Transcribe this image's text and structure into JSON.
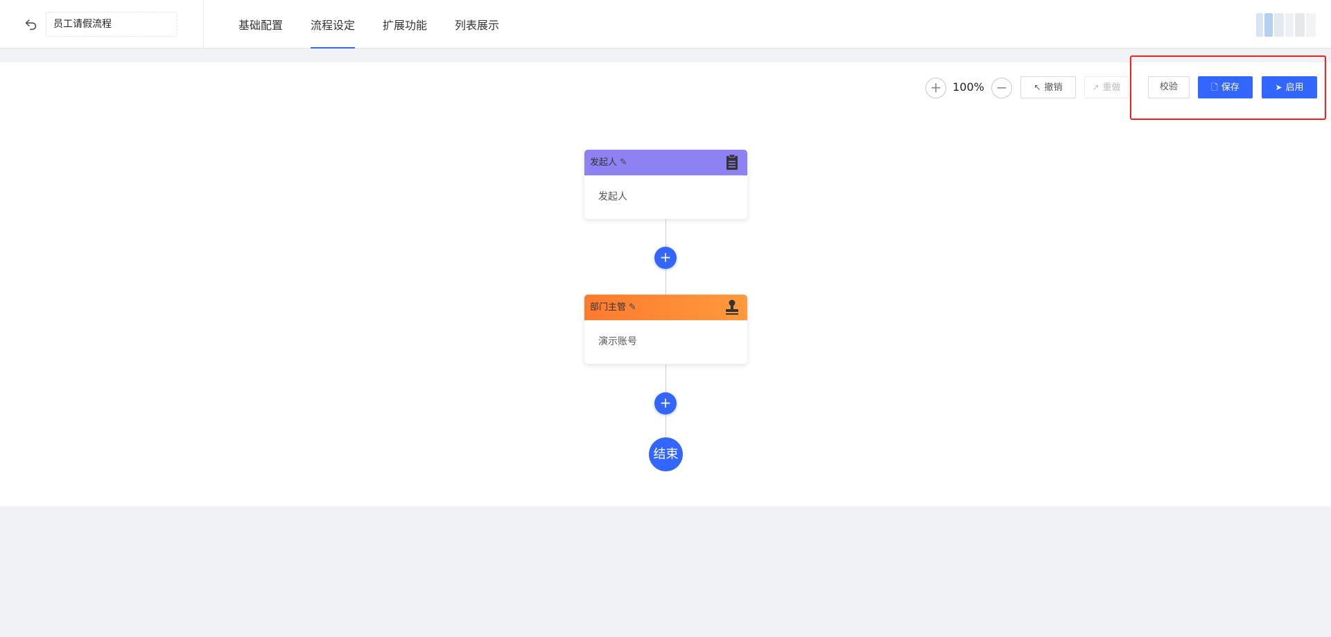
{
  "header": {
    "title": "员工请假流程",
    "tabs": [
      {
        "label": "基础配置",
        "active": false
      },
      {
        "label": "流程设定",
        "active": true
      },
      {
        "label": "扩展功能",
        "active": false
      },
      {
        "label": "列表展示",
        "active": false
      }
    ]
  },
  "toolbar": {
    "zoom_in": "+",
    "zoom_level": "100%",
    "zoom_out": "−",
    "undo_label": "撤销",
    "redo_label": "重做",
    "validate_label": "校验",
    "save_label": "保存",
    "publish_label": "启用"
  },
  "flow": {
    "start_node": {
      "title": "发起人",
      "content": "发起人",
      "color": "#8e82f2"
    },
    "approve_node": {
      "title": "部门主管",
      "content": "演示账号",
      "color": "#ff7a2e"
    },
    "add_symbol": "+",
    "end_label": "结束"
  },
  "colors": {
    "primary": "#3366ff",
    "highlight": "#ff1a1a"
  }
}
